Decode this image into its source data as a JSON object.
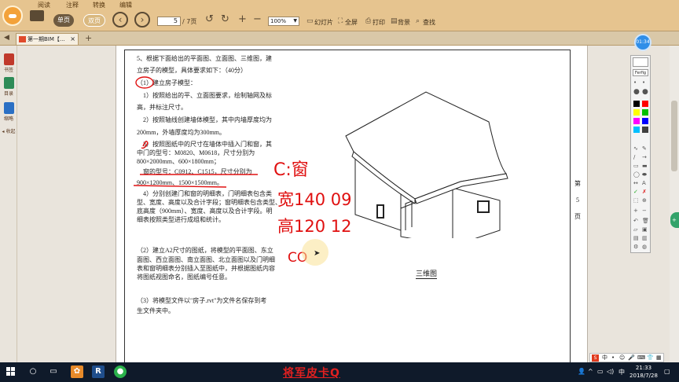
{
  "ribbon": {
    "menu_tabs": [
      "阅读",
      "注释",
      "转换",
      "编辑"
    ],
    "view_single": "单页",
    "view_double": "双页",
    "current_page": "5",
    "total_pages": "/ 7页",
    "zoom": "100%",
    "slideshow": "幻灯片",
    "fullscreen": "全屏",
    "print": "打印",
    "background": "背景",
    "find": "查找"
  },
  "tabbar": {
    "doc_tab": "第一期BIM【...",
    "close": "×",
    "add": "+"
  },
  "sidebar": {
    "items": [
      {
        "label": "书签",
        "color": "#c0392b"
      },
      {
        "label": "目录",
        "color": "#2e8b57"
      },
      {
        "label": "缩略",
        "color": "#2a6fc4"
      }
    ],
    "collapse": "◂ 收起"
  },
  "document": {
    "q5_line1": "5、根据下面给出的平面图、立面图、三维图，建",
    "q5_line2": "立房子的模型，具体要求如下：（40分）",
    "p1": "（1）建立房子模型：",
    "p1_1a": "1）按照给出的平、立面图要求，绘制轴网及标",
    "p1_1b": "高，并标注尺寸。",
    "p1_2a": "2）按照轴线创建墙体模型，其中内墙厚度均为",
    "p1_2b": "200mm，外墙厚度均为300mm。",
    "p1_3a": "3）按照图纸中的尺寸在墙体中插入门和窗，其",
    "p1_3b": "中门的型号：M0820、M0618，尺寸分别为",
    "p1_3c": "800×2000mm、600×1800mm；",
    "p1_3d": "窗的型号：C0912、C1515，尺寸分别为",
    "p1_3e": "900×1200mm、1500×1500mm。",
    "p1_4a": "4）分别创建门和窗的明细表，门明细表包含类",
    "p1_4b": "型、宽度、高度以及合计字段；窗明细表包含类型、",
    "p1_4c": "底高度（900mm）、宽度、高度以及合计字段。明",
    "p1_4d": "细表按照类型进行成组和统计。",
    "p2a": "（2）建立A2尺寸的图纸，将模型的平面图、东立",
    "p2b": "面图、西立面图、南立面图、北立面图以及门明细",
    "p2c": "表和窗明细表分别插入至图纸中，并根据图纸内容",
    "p2d": "将图纸视图命名，图纸编号任意。",
    "p3a": "（3）将模型文件以\"房子.rvt\"为文件名保存到考",
    "p3b": "生文件夹中。",
    "figure_caption": "三维图",
    "side_page_top": "第",
    "side_page_num": "5",
    "side_page_bot": "页"
  },
  "annotations": {
    "ink1": "C:窗",
    "ink2": "宽140 09",
    "ink3": "高120 12",
    "ink4": "CO"
  },
  "palette": {
    "title": "Ferfig",
    "timer": "01:34",
    "swatches": [
      "#000000",
      "#808080",
      "#ff0000",
      "#ffff00",
      "#00c000",
      "#ff00ff",
      "#0000ff",
      "#8b0000",
      "#00bfff",
      "#404040"
    ]
  },
  "taskbar": {
    "caption": "将军皮卡Q",
    "time": "21:33",
    "date": "2018/7/28",
    "ime_lang": "中"
  }
}
